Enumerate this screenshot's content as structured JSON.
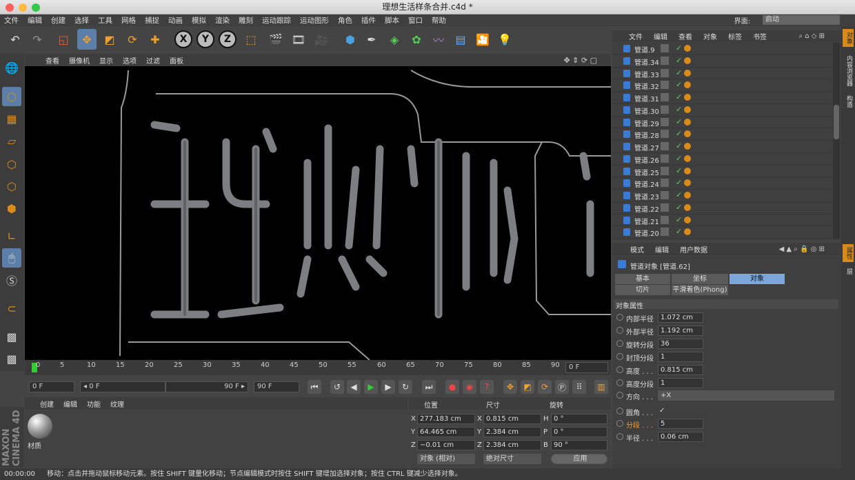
{
  "window": {
    "title": "理想生活样条合并.c4d *"
  },
  "menubar": {
    "items": [
      "文件",
      "编辑",
      "创建",
      "选择",
      "工具",
      "网格",
      "捕捉",
      "动画",
      "模拟",
      "渲染",
      "雕刻",
      "运动跟踪",
      "运动图形",
      "角色",
      "插件",
      "脚本",
      "窗口",
      "帮助"
    ],
    "layout_label": "界面:",
    "layout_value": "启动"
  },
  "viewport": {
    "menu": [
      "查看",
      "摄像机",
      "显示",
      "选项",
      "过滤",
      "面板"
    ],
    "scene_text": "理想生活"
  },
  "timeline": {
    "ticks": [
      "0",
      "5",
      "10",
      "15",
      "20",
      "25",
      "30",
      "35",
      "40",
      "45",
      "50",
      "55",
      "60",
      "65",
      "70",
      "75",
      "80",
      "85",
      "90"
    ],
    "current_frame": "0 F"
  },
  "playback": {
    "start_field": "0 F",
    "range_start": "◂ 0 F",
    "range_end": "90 F ▸",
    "end_field": "90 F"
  },
  "material_manager": {
    "menu": [
      "创建",
      "编辑",
      "功能",
      "纹理"
    ],
    "material_name": "材质"
  },
  "coordinates": {
    "headers": {
      "position": "位置",
      "size": "尺寸",
      "rotation": "旋转"
    },
    "rows": [
      {
        "axis": "X",
        "pos": "277.183 cm",
        "size_axis": "X",
        "size": "0.815 cm",
        "rot_axis": "H",
        "rot": "0 °"
      },
      {
        "axis": "Y",
        "pos": "64.465 cm",
        "size_axis": "Y",
        "size": "2.384 cm",
        "rot_axis": "P",
        "rot": "0 °"
      },
      {
        "axis": "Z",
        "pos": "−0.01 cm",
        "size_axis": "Z",
        "size": "2.384 cm",
        "rot_axis": "B",
        "rot": "90 °"
      }
    ],
    "mode_select": "对象 (相对)",
    "size_select": "绝对尺寸",
    "apply_label": "应用"
  },
  "object_manager": {
    "menu": [
      "文件",
      "编辑",
      "查看",
      "对象",
      "标签",
      "书签"
    ],
    "objects": [
      "管道.9",
      "管道.34",
      "管道.33",
      "管道.32",
      "管道.31",
      "管道.30",
      "管道.29",
      "管道.28",
      "管道.27",
      "管道.26",
      "管道.25",
      "管道.24",
      "管道.23",
      "管道.22",
      "管道.21",
      "管道.20"
    ]
  },
  "attribute_manager": {
    "menu": [
      "模式",
      "编辑",
      "用户数据"
    ],
    "object_title": "管道对象 [管道.62]",
    "tabs": [
      "基本",
      "坐标",
      "对象",
      "切片",
      "平滑着色(Phong)"
    ],
    "section": "对象属性",
    "props": [
      {
        "label": "内部半径",
        "value": "1.072 cm"
      },
      {
        "label": "外部半径",
        "value": "1.192 cm"
      },
      {
        "label": "旋转分段",
        "value": "36"
      },
      {
        "label": "封顶分段",
        "value": "1"
      },
      {
        "label": "高度 . . .",
        "value": "0.815 cm"
      },
      {
        "label": "高度分段",
        "value": "1"
      },
      {
        "label": "方向 . . .",
        "value": "+X"
      }
    ],
    "fillet_props": [
      {
        "label": "圆角 . . .",
        "value": "✓"
      },
      {
        "label": "分段 . . .",
        "value": "5"
      },
      {
        "label": "半径 . . .",
        "value": "0.06 cm"
      }
    ]
  },
  "right_tabs": [
    "对象",
    "内容浏览器",
    "构造",
    "属性",
    "层"
  ],
  "brand": "MAXON CINEMA 4D",
  "status": {
    "time": "00:00:00",
    "message": "移动：点击并拖动鼠标移动元素。按住 SHIFT 键量化移动；节点编辑模式时按住 SHIFT 键增加选择对象；按住 CTRL 键减少选择对象。"
  },
  "colors": {
    "accent": "#5b7fa8",
    "tag_orange": "#d88a1a",
    "selected_tab": "#7aa6d9"
  }
}
